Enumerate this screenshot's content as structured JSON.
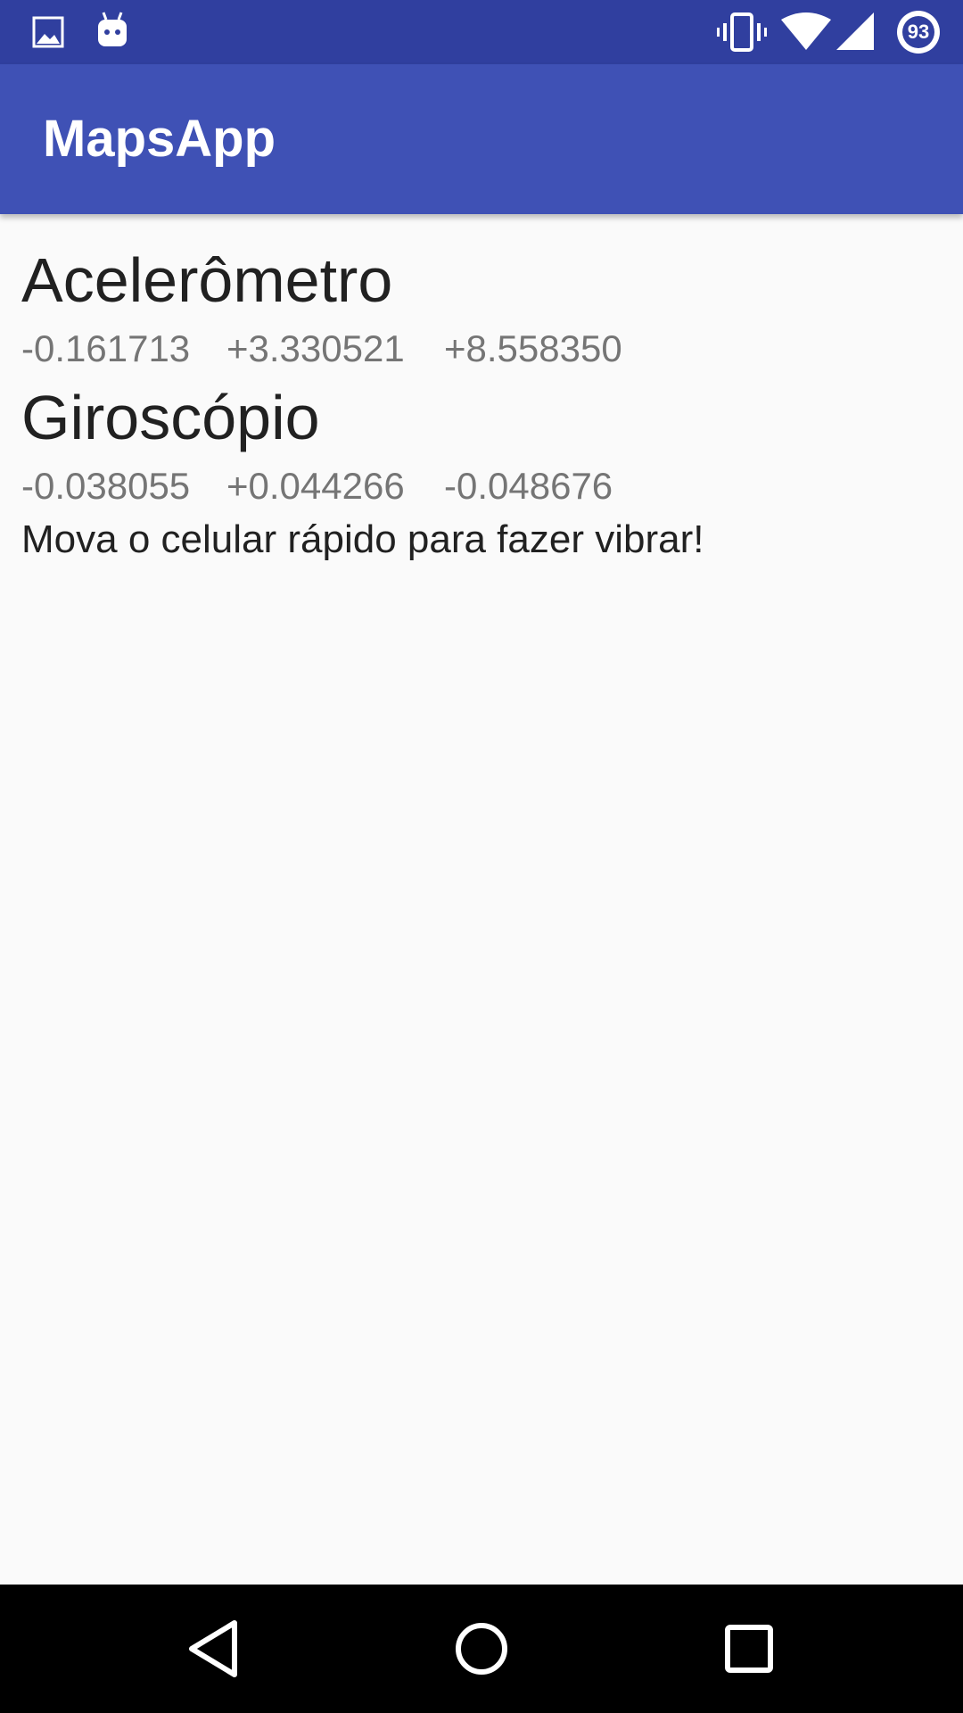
{
  "app": {
    "title": "MapsApp"
  },
  "status_bar": {
    "battery_level": "93",
    "icons": [
      "image-notification-icon",
      "android-notification-icon",
      "vibrate-icon",
      "wifi-icon",
      "cell-signal-icon",
      "battery-icon"
    ]
  },
  "accelerometer": {
    "heading": "Acelerômetro",
    "x": "-0.161713",
    "y": "+3.330521",
    "z": "+8.558350"
  },
  "gyroscope": {
    "heading": "Giroscópio",
    "x": "-0.038055",
    "y": "+0.044266",
    "z": "-0.048676"
  },
  "message": "Mova o celular rápido para fazer vibrar!",
  "navigation": {
    "icons": [
      "back-icon",
      "home-icon",
      "recents-icon"
    ]
  },
  "colors": {
    "status_bar": "#303f9f",
    "app_bar": "#3f51b5",
    "background": "#fafafa",
    "nav_bar": "#000000"
  }
}
